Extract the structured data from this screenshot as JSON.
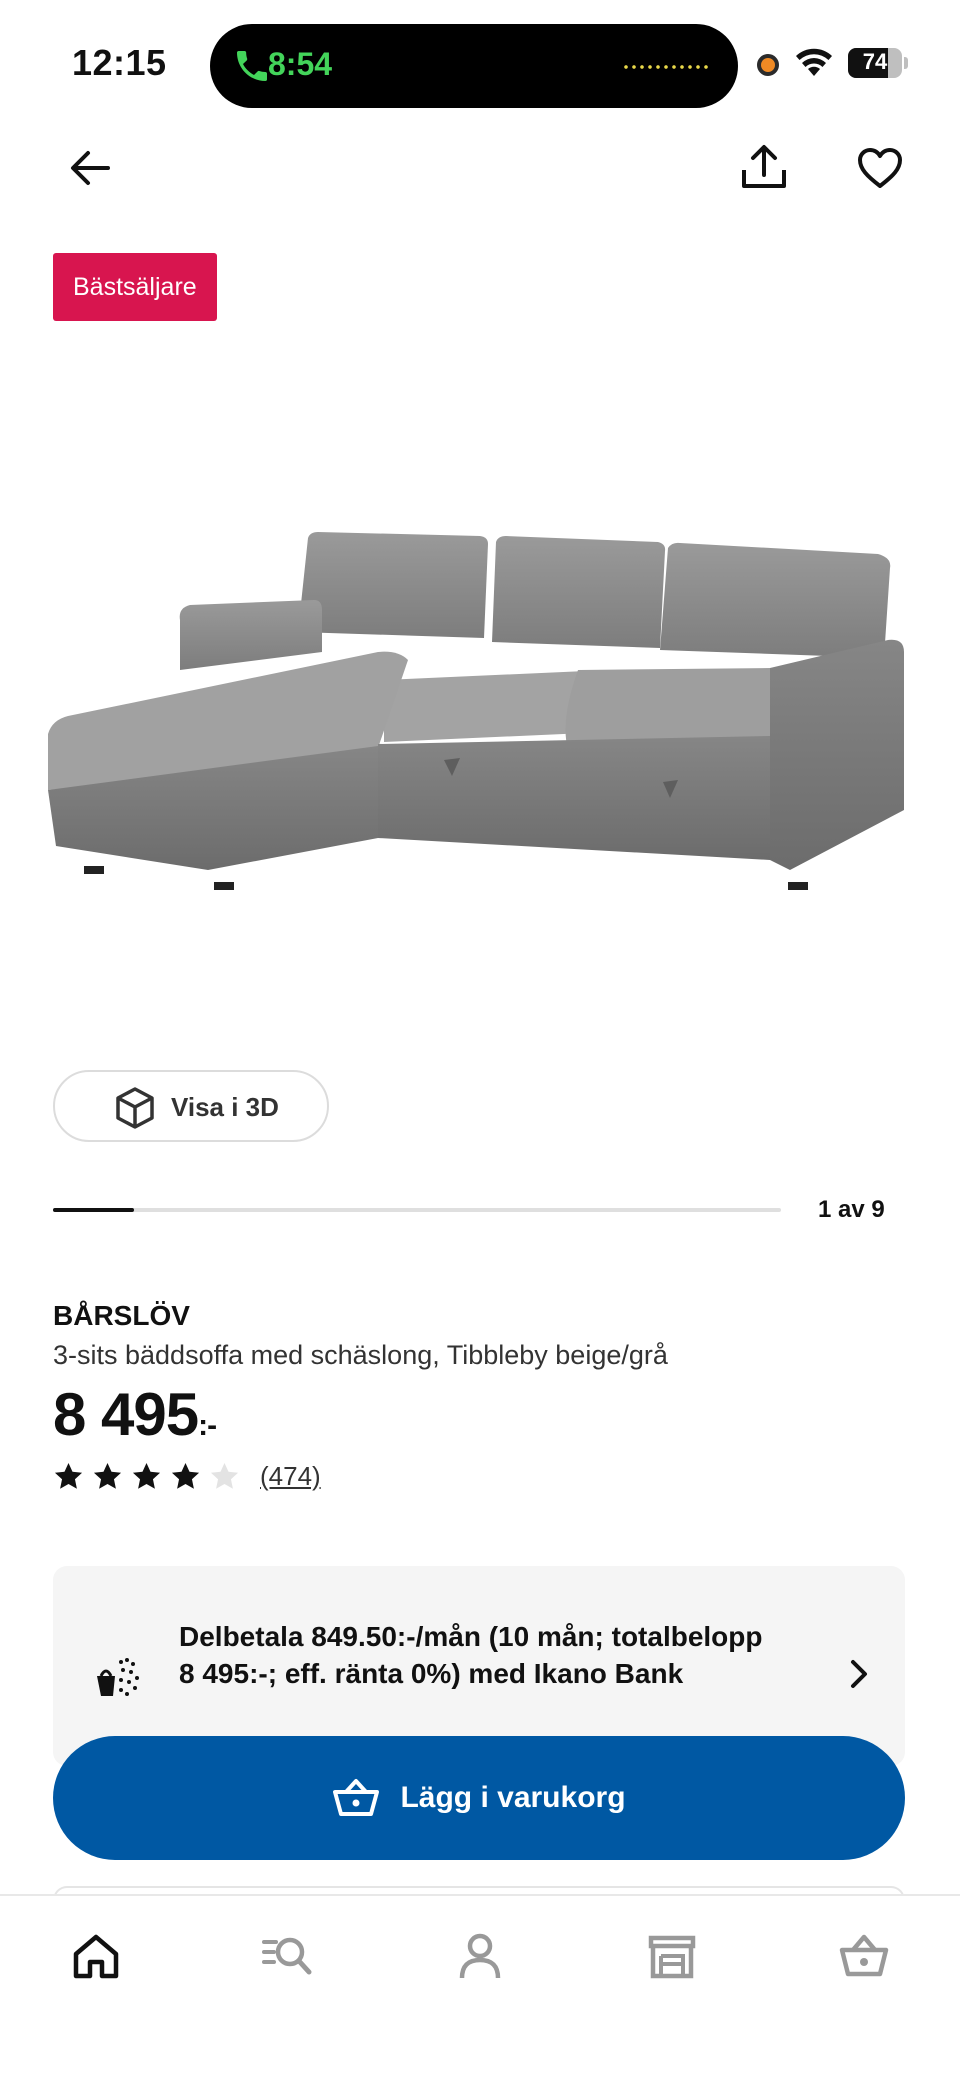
{
  "status_bar": {
    "time": "12:15",
    "call_time": "8:54",
    "battery_level": "74",
    "battery_fraction": 0.74
  },
  "nav": {
    "back_icon": "arrow-left-icon",
    "share_icon": "share-icon",
    "favorite_icon": "heart-icon"
  },
  "badge": "Bästsäljare",
  "product_image_alt": "sofa",
  "view_3d": {
    "label": "Visa i 3D",
    "icon": "cube-icon"
  },
  "carousel": {
    "counter": "1 av 9",
    "current": 1,
    "total": 9
  },
  "product": {
    "name": "BÅRSLÖV",
    "description": "3-sits bäddsoffa med schäslong, Tibbleby beige/grå",
    "price": "8 495",
    "price_suffix": ":-",
    "rating": 4,
    "rating_max": 5,
    "review_count": "(474)"
  },
  "installment": {
    "text": "Delbetala 849.50:-/mån (10 mån; totalbelopp 8 495:-; eff. ränta 0%) med Ikano Bank",
    "icon": "payment-icon"
  },
  "cart_button": {
    "label": "Lägg i varukorg",
    "icon": "basket-icon"
  },
  "tabs": [
    {
      "name": "home",
      "icon": "home-icon",
      "active": true
    },
    {
      "name": "search",
      "icon": "search-list-icon",
      "active": false
    },
    {
      "name": "profile",
      "icon": "person-icon",
      "active": false
    },
    {
      "name": "store",
      "icon": "store-icon",
      "active": false
    },
    {
      "name": "cart",
      "icon": "basket-icon",
      "active": false
    }
  ],
  "colors": {
    "brand_blue": "#0058a3",
    "badge_red": "#d8154f",
    "call_green": "#43d45a"
  }
}
